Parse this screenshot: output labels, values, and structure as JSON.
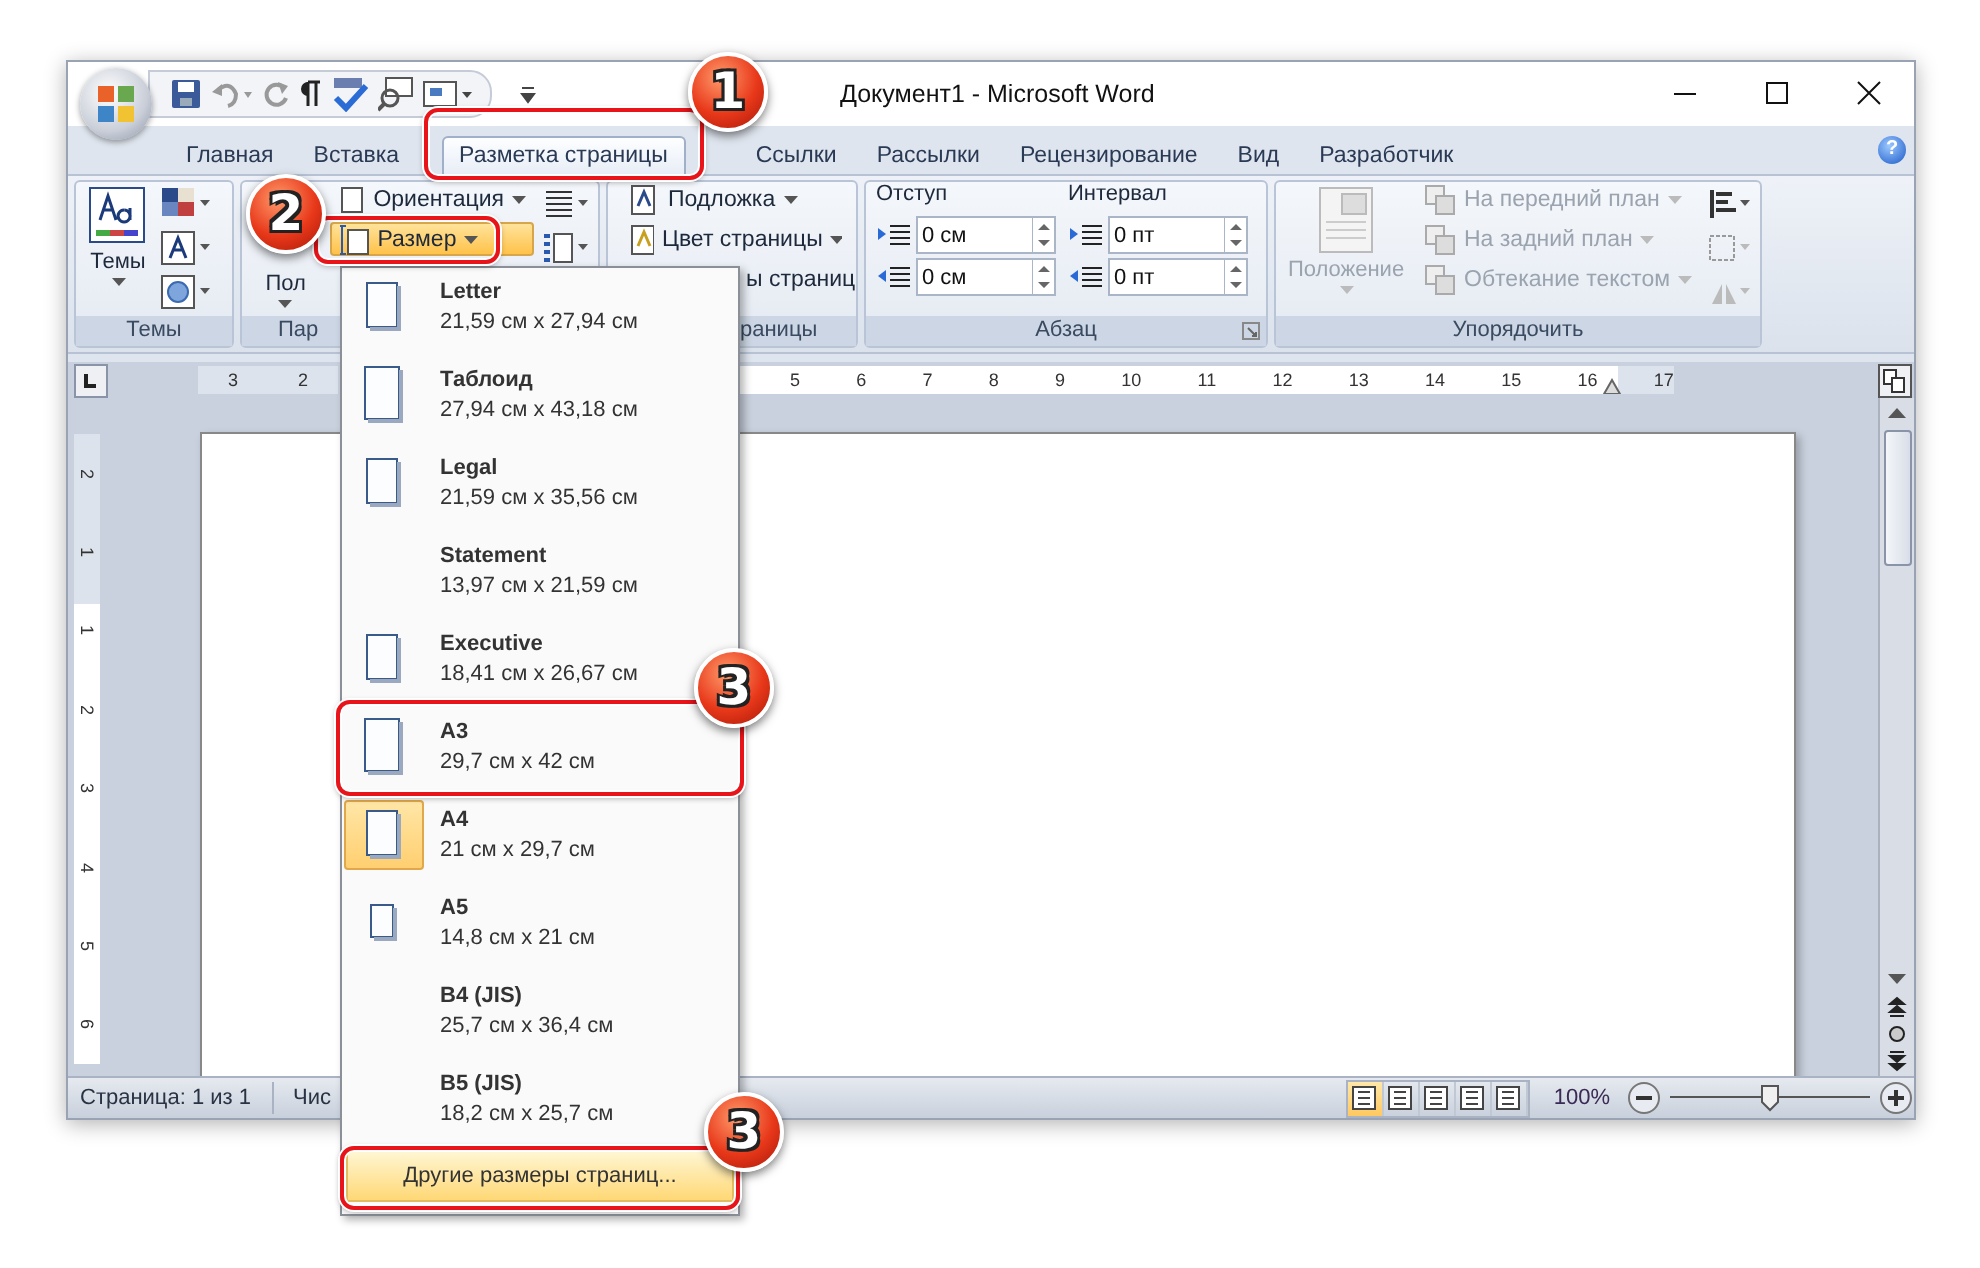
{
  "window": {
    "title": "Документ1 - Microsoft Word"
  },
  "tabs": [
    {
      "label": "Главная",
      "selected": false
    },
    {
      "label": "Вставка",
      "selected": false
    },
    {
      "label": "Разметка страницы",
      "selected": true
    },
    {
      "label": "Ссылки",
      "selected": false
    },
    {
      "label": "Рассылки",
      "selected": false
    },
    {
      "label": "Рецензирование",
      "selected": false
    },
    {
      "label": "Вид",
      "selected": false
    },
    {
      "label": "Разработчик",
      "selected": false
    }
  ],
  "help_button": "?",
  "ribbon": {
    "themes_group": {
      "button": "Темы",
      "label": "Темы"
    },
    "page_setup_group": {
      "margins_button": "Пол",
      "orientation_button": "Ориентация",
      "size_button": {
        "label": "Размер",
        "pressed": true
      },
      "label": "Пар"
    },
    "page_background_group": {
      "buttons": [
        "Подложка",
        "Цвет страницы",
        "ы страниц"
      ],
      "label": "раницы"
    },
    "paragraph_group": {
      "indent": {
        "title": "Отступ",
        "fields": [
          "0 см",
          "0 см"
        ]
      },
      "spacing": {
        "title": "Интервал",
        "fields": [
          "0 пт",
          "0 пт"
        ]
      },
      "label": "Абзац"
    },
    "arrange_group": {
      "position_button": {
        "label": "Положение",
        "disabled": true
      },
      "items": [
        {
          "label": "На передний план",
          "disabled": true
        },
        {
          "label": "На задний план",
          "disabled": true
        },
        {
          "label": "Обтекание текстом",
          "disabled": true
        }
      ],
      "label": "Упорядочить"
    }
  },
  "ruler": {
    "left_numbers": [
      "3",
      "2"
    ],
    "right_numbers": [
      "5",
      "6",
      "7",
      "8",
      "9",
      "10",
      "11",
      "12",
      "13",
      "14",
      "15",
      "16",
      "17"
    ],
    "vertical_numbers": [
      "2",
      "1",
      "1",
      "2",
      "3",
      "4",
      "5",
      "6"
    ]
  },
  "size_menu": {
    "items": [
      {
        "name": "Letter",
        "size": "21,59 см x 27,94 см",
        "kind": "regular",
        "selected": false
      },
      {
        "name": "Таблоид",
        "size": "27,94 см x 43,18 см",
        "kind": "tall",
        "selected": false
      },
      {
        "name": "Legal",
        "size": "21,59 см x 35,56 см",
        "kind": "regular",
        "selected": false
      },
      {
        "name": "Statement",
        "size": "13,97 см x 21,59 см",
        "kind": "blank",
        "selected": false
      },
      {
        "name": "Executive",
        "size": "18,41 см x 26,67 см",
        "kind": "regular",
        "selected": false
      },
      {
        "name": "A3",
        "size": "29,7 см x 42 см",
        "kind": "tall",
        "selected": false
      },
      {
        "name": "A4",
        "size": "21 см x 29,7 см",
        "kind": "regular",
        "selected": true
      },
      {
        "name": "A5",
        "size": "14,8 см x 21 см",
        "kind": "small",
        "selected": false
      },
      {
        "name": "B4 (JIS)",
        "size": "25,7 см x 36,4 см",
        "kind": "blank",
        "selected": false
      },
      {
        "name": "B5 (JIS)",
        "size": "18,2 см x 25,7 см",
        "kind": "blank",
        "selected": false
      }
    ],
    "more_button": "Другие размеры страниц..."
  },
  "status_bar": {
    "page": "Страница: 1 из 1",
    "words": "Чис",
    "view_buttons": [
      {
        "selected": true
      },
      {
        "selected": false
      },
      {
        "selected": false
      },
      {
        "selected": false
      },
      {
        "selected": false
      }
    ],
    "zoom": "100%",
    "zoom_slider": {
      "level": 0.5
    }
  },
  "callouts": [
    {
      "number": "1"
    },
    {
      "number": "2"
    },
    {
      "number": "3"
    },
    {
      "number": "3"
    }
  ]
}
